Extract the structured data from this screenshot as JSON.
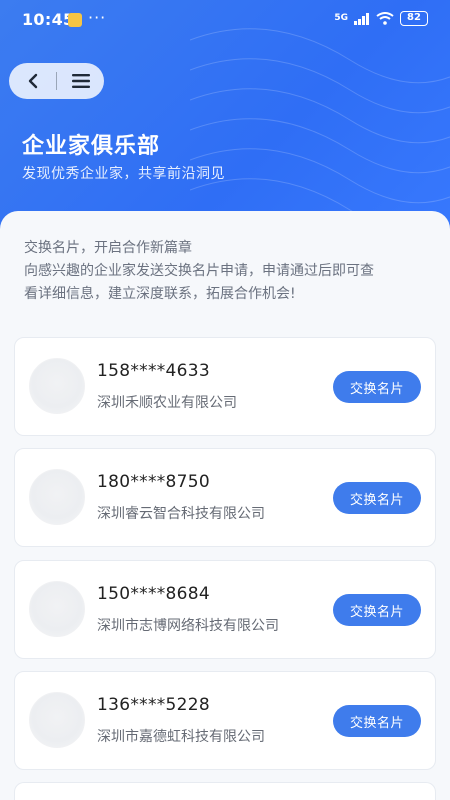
{
  "status_bar": {
    "time": "10:45",
    "network": "5G",
    "battery": "82"
  },
  "icons": {
    "back": "back-arrow-icon",
    "menu": "menu-icon",
    "signal": "signal-icon",
    "wifi": "wifi-icon",
    "battery": "battery-icon",
    "notification": "app-notification-icon"
  },
  "header": {
    "title": "企业家俱乐部",
    "subtitle": "发现优秀企业家，共享前沿洞见"
  },
  "intro": {
    "line1": "交换名片，开启合作新篇章",
    "line2": "向感兴趣的企业家发送交换名片申请，申请通过后即可查",
    "line3": "看详细信息，建立深度联系，拓展合作机会!"
  },
  "cards": [
    {
      "phone": "158****4633",
      "company": "深圳禾顺农业有限公司",
      "button": "交换名片"
    },
    {
      "phone": "180****8750",
      "company": "深圳睿云智合科技有限公司",
      "button": "交换名片"
    },
    {
      "phone": "150****8684",
      "company": "深圳市志博网络科技有限公司",
      "button": "交换名片"
    },
    {
      "phone": "136****5228",
      "company": "深圳市嘉德虹科技有限公司",
      "button": "交换名片"
    }
  ],
  "colors": {
    "accent": "#3f7cec",
    "hero": "#2f6ef5"
  }
}
